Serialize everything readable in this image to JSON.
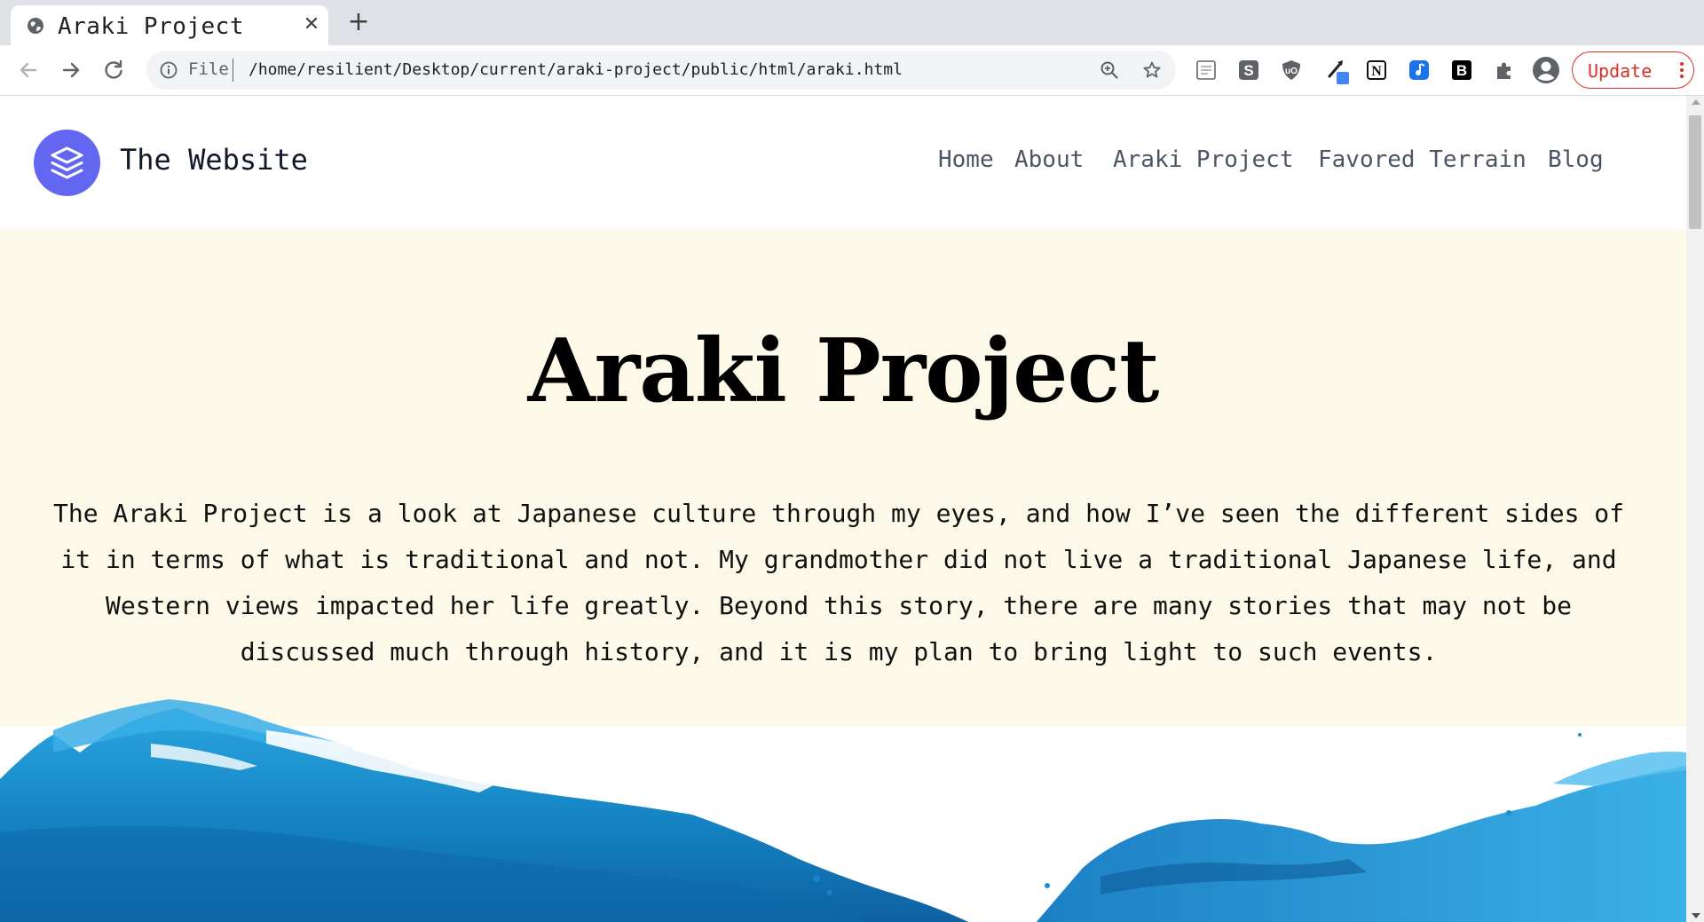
{
  "browser": {
    "tab_title": "Araki Project",
    "address": {
      "scheme_label": "File",
      "url": "/home/resilient/Desktop/current/araki-project/public/html/araki.html"
    },
    "update_label": "Update"
  },
  "site": {
    "name": "The Website",
    "nav": [
      "Home",
      "About",
      "Araki Project",
      "Favored Terrain",
      "Blog"
    ]
  },
  "hero": {
    "title": "Araki Project",
    "body": "The Araki Project is a look at Japanese culture through my eyes, and how I’ve seen the different sides of it in terms of what is traditional and not. My grandmother did not live a traditional Japanese life, and Western views impacted her life greatly. Beyond this story, there are many stories that may not be discussed much through history, and it is my plan to bring light to such events."
  },
  "colors": {
    "accent": "#6366f1",
    "hero_bg": "#fdf9e8",
    "update_red": "#d93025",
    "wave_blue": "#1a8fd0"
  }
}
